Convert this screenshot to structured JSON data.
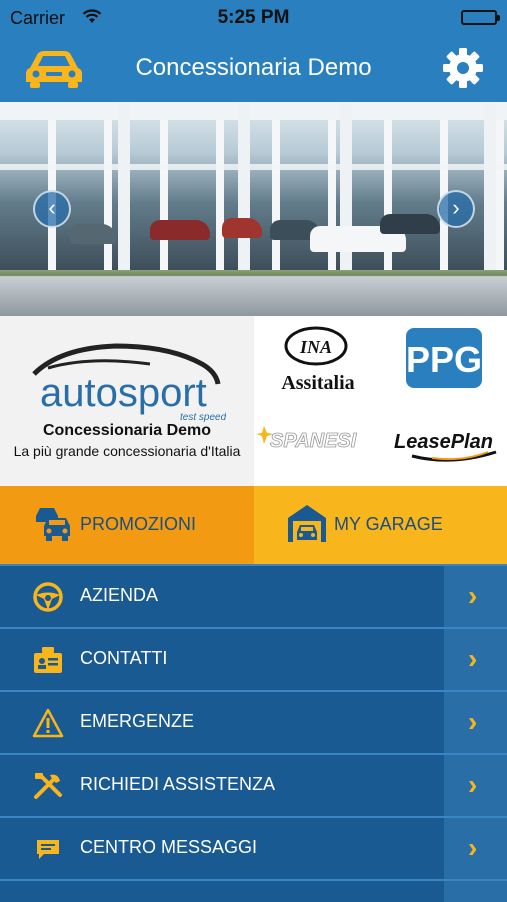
{
  "status_bar": {
    "carrier": "Carrier",
    "time": "5:25 PM"
  },
  "nav": {
    "title": "Concessionaria Demo",
    "left_icon": "car-icon",
    "right_icon": "gear-icon"
  },
  "banner": {
    "prev_icon": "chevron-left-icon",
    "next_icon": "chevron-right-icon"
  },
  "brands": {
    "main_logo": {
      "word": "autosport",
      "tagline": "test speed"
    },
    "main_name": "Concessionaria Demo",
    "main_sub": "La più grande concessionaria d'Italia",
    "partners": [
      {
        "badge": "INA",
        "name": "Assitalia"
      },
      {
        "name": "PPG"
      },
      {
        "name": "SPANESI"
      },
      {
        "name": "LeasePlan"
      }
    ]
  },
  "actions": [
    {
      "label": "PROMOZIONI",
      "icon": "cars-icon"
    },
    {
      "label": "MY GARAGE",
      "icon": "garage-icon"
    }
  ],
  "menu": [
    {
      "label": "AZIENDA",
      "icon": "steering-wheel-icon"
    },
    {
      "label": "CONTATTI",
      "icon": "contact-card-icon"
    },
    {
      "label": "EMERGENZE",
      "icon": "warning-icon"
    },
    {
      "label": "RICHIEDI ASSISTENZA",
      "icon": "tools-icon"
    },
    {
      "label": "CENTRO MESSAGGI",
      "icon": "message-icon"
    }
  ],
  "colors": {
    "primary": "#2a7fbf",
    "menu_bg": "#1a5a92",
    "accent": "#f8b51c",
    "promo": "#f29a12"
  }
}
